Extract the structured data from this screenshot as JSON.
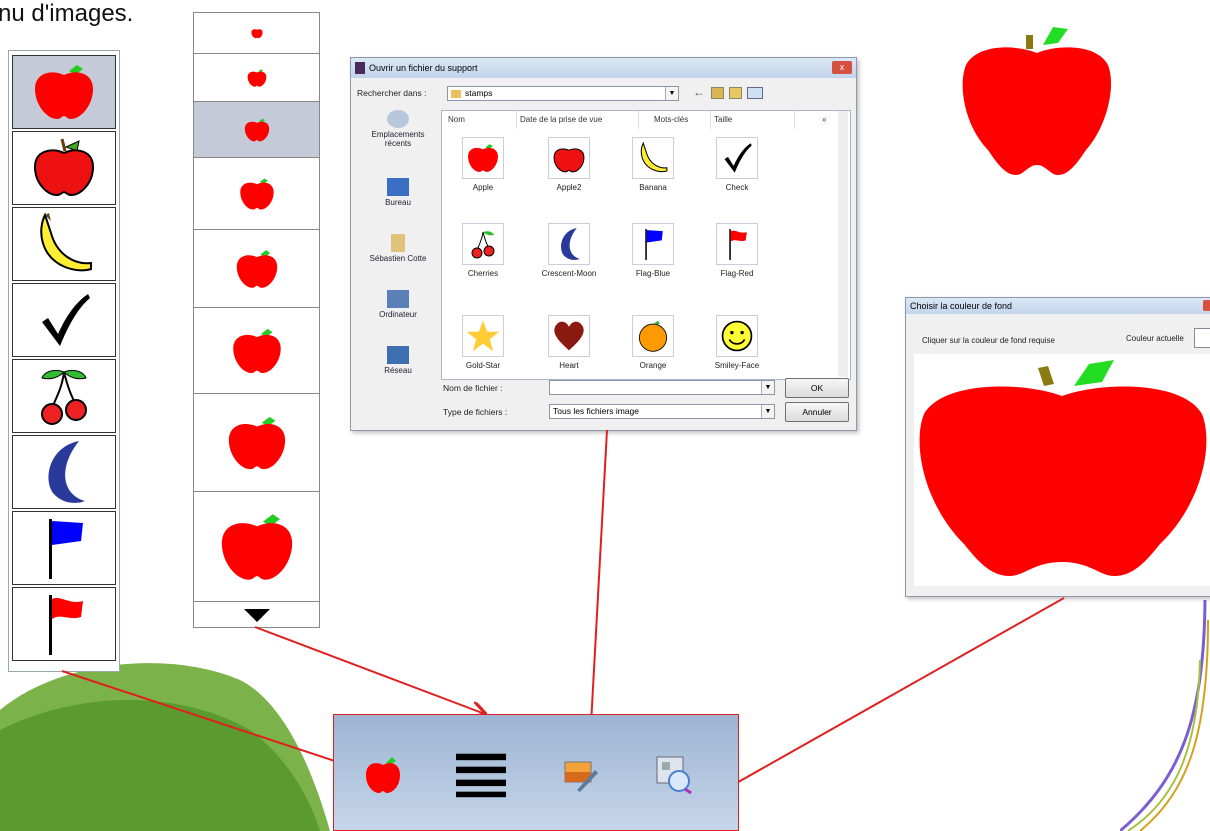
{
  "page_title": "nu d'images.",
  "colors": {
    "apple_red": "#ff0000",
    "leaf_green": "#22cc22",
    "arrow_red": "#e02020",
    "selection": "#c5cad8"
  },
  "stamp_column": {
    "items": [
      {
        "name": "apple",
        "icon": "apple-icon",
        "selected": true
      },
      {
        "name": "apple2",
        "icon": "apple2-icon",
        "selected": false
      },
      {
        "name": "banana",
        "icon": "banana-icon",
        "selected": false
      },
      {
        "name": "check",
        "icon": "check-icon",
        "selected": false
      },
      {
        "name": "cherries",
        "icon": "cherries-icon",
        "selected": false
      },
      {
        "name": "crescent-moon",
        "icon": "crescent-moon-icon",
        "selected": false
      },
      {
        "name": "flag-blue",
        "icon": "flag-blue-icon",
        "selected": false
      },
      {
        "name": "flag-red",
        "icon": "flag-red-icon",
        "selected": false
      }
    ]
  },
  "size_column": {
    "levels": 8,
    "selected_index": 2,
    "scroll_icon": "triangle-down-icon"
  },
  "open_dialog": {
    "title": "Ouvrir un fichier du support",
    "close_label": "x",
    "look_in_label": "Rechercher dans :",
    "look_in_value": "stamps",
    "places": [
      "Emplacements récents",
      "Bureau",
      "Sébastien Cotte",
      "Ordinateur",
      "Réseau"
    ],
    "columns": [
      "Nom",
      "Date de la prise de vue",
      "Mots-clés",
      "Taille",
      "»"
    ],
    "files": [
      "Apple",
      "Apple2",
      "Banana",
      "Check",
      "Cherries",
      "Crescent-Moon",
      "Flag-Blue",
      "Flag-Red",
      "Gold-Star",
      "Heart",
      "Orange",
      "Smiley-Face"
    ],
    "filename_label": "Nom de fichier :",
    "filename_value": "",
    "filetype_label": "Type de fichiers :",
    "filetype_value": "Tous les fichiers image",
    "ok_label": "OK",
    "cancel_label": "Annuler"
  },
  "color_dialog": {
    "title": "Choisir la couleur de fond",
    "instruction": "Cliquer sur la couleur de fond requise",
    "current_label": "Couleur actuelle"
  },
  "toolbar": {
    "buttons": [
      {
        "name": "stamp-tool",
        "icon": "apple-icon"
      },
      {
        "name": "size-tool",
        "icon": "lines-icon"
      },
      {
        "name": "open-image-tool",
        "icon": "image-edit-icon"
      },
      {
        "name": "background-color-tool",
        "icon": "zoom-picture-icon"
      }
    ]
  }
}
